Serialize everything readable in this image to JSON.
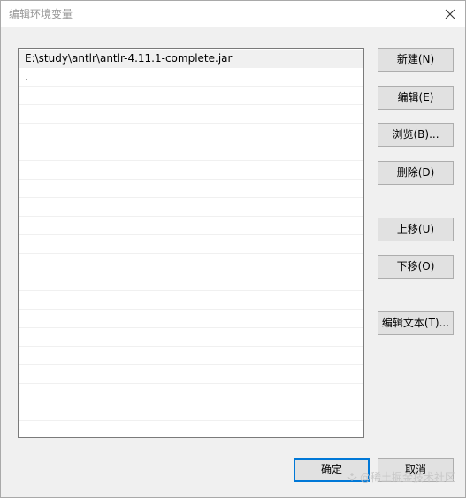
{
  "window": {
    "title": "编辑环境变量"
  },
  "list": {
    "items": [
      "E:\\study\\antlr\\antlr-4.11.1-complete.jar",
      "."
    ],
    "selected_index": 0
  },
  "buttons": {
    "new": "新建(N)",
    "edit": "编辑(E)",
    "browse": "浏览(B)...",
    "delete": "删除(D)",
    "move_up": "上移(U)",
    "move_down": "下移(O)",
    "edit_text": "编辑文本(T)...",
    "ok": "确定",
    "cancel": "取消"
  },
  "watermark": "@稀土掘金技术社区",
  "colors": {
    "dialog_bg": "#f0f0f0",
    "selection": "#f0f0f0",
    "accent": "#0078d7",
    "button_bg": "#e1e1e1"
  },
  "icons": {
    "close": "close-icon",
    "watermark": "juejin-logo-icon"
  }
}
